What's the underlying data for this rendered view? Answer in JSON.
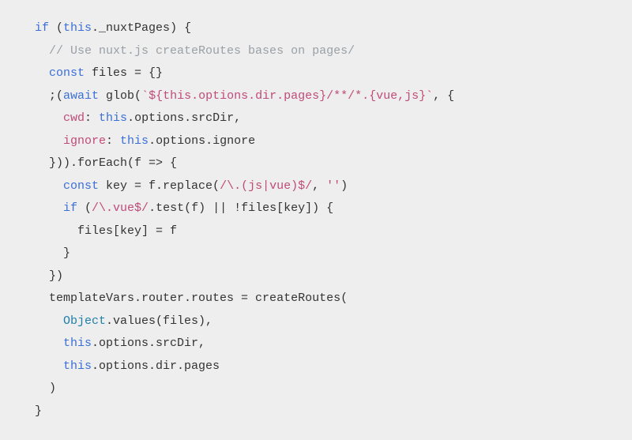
{
  "code": {
    "l1": {
      "a": "if",
      "b": " (",
      "c": "this",
      "d": "._nuxtPages) {"
    },
    "l2": {
      "a": "// Use nuxt.js createRoutes bases on pages/"
    },
    "l3": {
      "a": "const",
      "b": " files = {}"
    },
    "l4": {
      "a": ";(",
      "b": "await",
      "c": " glob(",
      "d": "`${this.options.dir.pages}/**/*.{vue,js}`",
      "e": ", {"
    },
    "l5": {
      "a": "cwd",
      "b": ": ",
      "c": "this",
      "d": ".options.srcDir,"
    },
    "l6": {
      "a": "ignore",
      "b": ": ",
      "c": "this",
      "d": ".options.ignore"
    },
    "l7": {
      "a": "})).forEach(f => {"
    },
    "l8": {
      "a": "const",
      "b": " key = f.replace(",
      "c": "/\\.(js|vue)$/",
      "d": ", ",
      "e": "''",
      "f": ")"
    },
    "l9": {
      "a": "if",
      "b": " (",
      "c": "/\\.vue$/",
      "d": ".test(f) || !files[key]) {"
    },
    "l10": {
      "a": "files[key] = f"
    },
    "l11": {
      "a": "}"
    },
    "l12": {
      "a": "})"
    },
    "l13": {
      "a": "templateVars.router.routes = createRoutes("
    },
    "l14": {
      "a": "Object",
      "b": ".values(files),"
    },
    "l15": {
      "a": "this",
      "b": ".options.srcDir,"
    },
    "l16": {
      "a": "this",
      "b": ".options.dir.pages"
    },
    "l17": {
      "a": ")"
    },
    "l18": {
      "a": "}"
    }
  }
}
